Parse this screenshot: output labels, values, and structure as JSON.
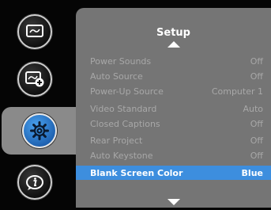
{
  "sidebar": {
    "items": [
      {
        "name": "display",
        "icon": "display-icon"
      },
      {
        "name": "display-plus",
        "icon": "display-plus-icon"
      },
      {
        "name": "setup",
        "icon": "gear-icon",
        "active": true
      },
      {
        "name": "information",
        "icon": "info-icon"
      }
    ]
  },
  "menu": {
    "title": "Setup",
    "rows": [
      {
        "label": "Power Sounds",
        "value": "Off"
      },
      {
        "label": "Auto Source",
        "value": "Off"
      },
      {
        "label": "Power-Up Source",
        "value": "Computer 1"
      },
      {
        "label": "Video Standard",
        "value": "Auto"
      },
      {
        "label": "Closed Captions",
        "value": "Off"
      },
      {
        "label": "Rear Project",
        "value": "Off"
      },
      {
        "label": "Auto Keystone",
        "value": "Off"
      },
      {
        "label": "Blank Screen Color",
        "value": "Blue",
        "selected": true
      }
    ]
  },
  "colors": {
    "panel": "#757575",
    "selection": "#3d8ede",
    "active_icon": "#2f7ad0",
    "dim_text": "#a8a8a8"
  }
}
